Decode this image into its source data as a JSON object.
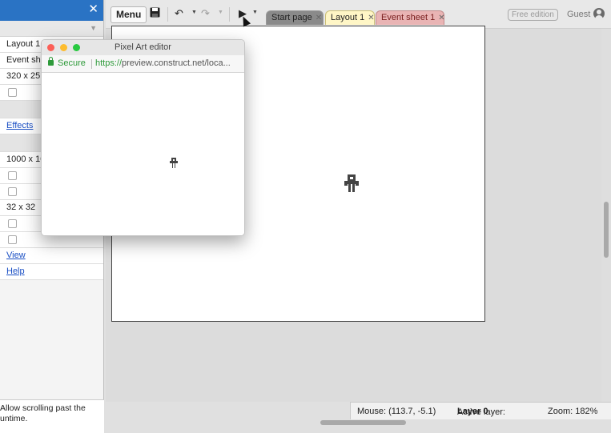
{
  "left_panel": {
    "close_icon": "close-icon",
    "filter_icon": "chevron-down-icon",
    "rows": [
      {
        "kind": "text",
        "value": "Layout 1"
      },
      {
        "kind": "text",
        "value": "Event sh"
      },
      {
        "kind": "text",
        "value": "320 x 25"
      },
      {
        "kind": "checkbox"
      },
      {
        "kind": "section"
      },
      {
        "kind": "link",
        "value": "Effects"
      },
      {
        "kind": "section"
      },
      {
        "kind": "text",
        "value": "1000 x 10"
      },
      {
        "kind": "checkbox"
      },
      {
        "kind": "checkbox"
      },
      {
        "kind": "text",
        "value": "32 x 32"
      },
      {
        "kind": "checkbox"
      },
      {
        "kind": "checkbox"
      },
      {
        "kind": "link",
        "value": "View"
      },
      {
        "kind": "link",
        "value": "Help"
      }
    ],
    "description_line1": "Allow scrolling past the",
    "description_line2": "untime."
  },
  "toolbar": {
    "menu_label": "Menu",
    "save_icon": "save-icon",
    "undo_icon": "undo-icon",
    "redo_icon": "redo-icon",
    "play_icon": "play-icon",
    "tabs": [
      {
        "label": "Start page"
      },
      {
        "label": "Layout 1"
      },
      {
        "label": "Event sheet 1"
      }
    ],
    "free_edition_label": "Free edition",
    "guest_label": "Guest",
    "account_icon": "account-icon"
  },
  "preview_window": {
    "title": "Pixel Art editor",
    "secure_label": "Secure",
    "url_prefix": "https://",
    "url_main": "preview.construct.net",
    "url_rest": "/loca..."
  },
  "statusbar": {
    "mouse_label": "Mouse: (113.7, -5.1)",
    "active_layer_prefix": "Active layer:",
    "active_layer_value": "Layer 0",
    "zoom_label": "Zoom: 182%"
  },
  "colors": {
    "titlebar": "#2a73c4",
    "secure_green": "#2e9a3a",
    "tab_layout": "#fff6c6",
    "tab_event": "#e9b4b4"
  }
}
